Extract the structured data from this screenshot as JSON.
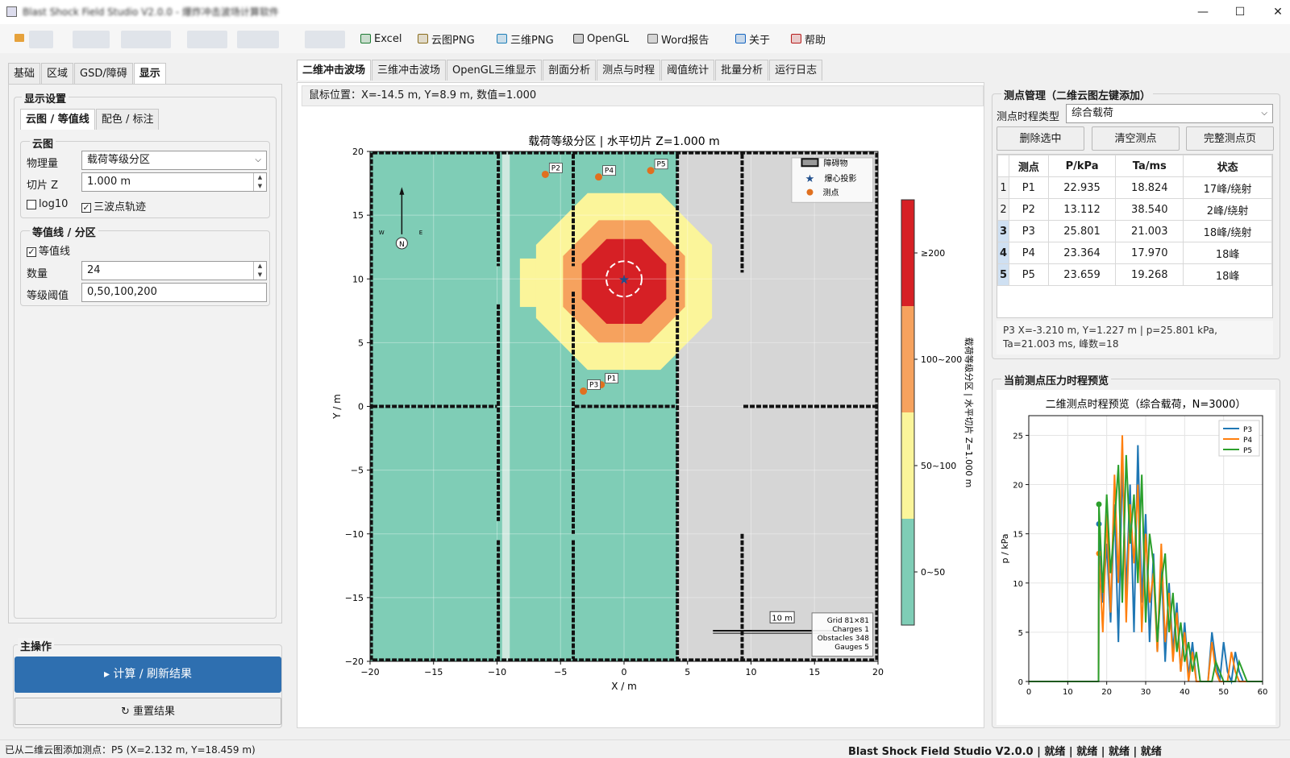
{
  "window": {
    "title": "Blast Shock Field Studio V2.0.0 - 爆炸冲击波场计算软件",
    "minimize": "—",
    "maximize": "☐",
    "close": "✕"
  },
  "toolbar": {
    "items": [
      {
        "label": "Excel",
        "icon": "excel-icon",
        "color": "#1e7b34"
      },
      {
        "label": "云图PNG",
        "icon": "image-icon",
        "color": "#8a6d1d"
      },
      {
        "label": "三维PNG",
        "icon": "globe-icon",
        "color": "#1e7fb8"
      },
      {
        "label": "OpenGL",
        "icon": "camera-icon",
        "color": "#333333"
      },
      {
        "label": "Word报告",
        "icon": "document-icon",
        "color": "#555555"
      },
      {
        "label": "关于",
        "icon": "info-icon",
        "color": "#1565c0"
      },
      {
        "label": "帮助",
        "icon": "help-icon",
        "color": "#b71c1c"
      }
    ]
  },
  "left": {
    "tabs": [
      "基础",
      "区域",
      "GSD/障碍",
      "显示"
    ],
    "active_tab": "显示",
    "display_group": "显示设置",
    "subtabs": [
      "云图 / 等值线",
      "配色 / 标注"
    ],
    "cloud_group": "云图",
    "quantity_label": "物理量",
    "quantity_value": "载荷等级分区",
    "slice_label": "切片 Z",
    "slice_value": "1.000 m",
    "log10_label": "log10",
    "log10_checked": false,
    "trace_label": "三波点轨迹",
    "trace_checked": true,
    "contour_group": "等值线 / 分区",
    "contour_label": "等值线",
    "contour_checked": true,
    "count_label": "数量",
    "count_value": "24",
    "threshold_label": "等级阈值",
    "threshold_value": "0,50,100,200",
    "main_ops": "主操作",
    "compute_button": "▸  计算 / 刷新结果",
    "reset_button": "↻  重置结果"
  },
  "center": {
    "tabs": [
      "二维冲击波场",
      "三维冲击波场",
      "OpenGL三维显示",
      "剖面分析",
      "测点与时程",
      "阈值统计",
      "批量分析",
      "运行日志"
    ],
    "active_tab": "二维冲击波场",
    "mouse_pos": "鼠标位置：X=-14.5 m, Y=8.9 m, 数值=1.000"
  },
  "chart_data": [
    {
      "type": "heatmap",
      "title": "载荷等级分区   |   水平切片 Z=1.000 m",
      "xlabel": "X / m",
      "ylabel": "Y / m",
      "xlim": [
        -20,
        20
      ],
      "ylim": [
        -20,
        20
      ],
      "xticks": [
        "−20",
        "−15",
        "−10",
        "−5",
        "0",
        "5",
        "10",
        "15",
        "20"
      ],
      "yticks": [
        "20",
        "15",
        "10",
        "5",
        "0",
        "−5",
        "−10",
        "−15",
        "−20"
      ],
      "grid": true,
      "legend": {
        "position": "top-right",
        "items": [
          "障碍物",
          "爆心投影",
          "测点"
        ]
      },
      "colorbar_label": "载荷等级分区 | 水平切片 Z=1.000 m",
      "colorbar": [
        {
          "label": "≥200",
          "color": "#d62025"
        },
        {
          "label": "100~200",
          "color": "#f6a25e"
        },
        {
          "label": "50~100",
          "color": "#fbf59a"
        },
        {
          "label": "0~50",
          "color": "#7fcdb6"
        }
      ],
      "charge": {
        "x": 0,
        "y": 10
      },
      "gauges": [
        {
          "name": "P1",
          "x": -1.8,
          "y": 1.7
        },
        {
          "name": "P2",
          "x": -6.2,
          "y": 18.2
        },
        {
          "name": "P3",
          "x": -3.2,
          "y": 1.2
        },
        {
          "name": "P4",
          "x": -2.0,
          "y": 18.0
        },
        {
          "name": "P5",
          "x": 2.1,
          "y": 18.5
        }
      ],
      "compass": [
        "N",
        "W",
        "E"
      ],
      "scalebar": "10 m",
      "info_box": [
        "Grid 81×81",
        "Charges 1",
        "Obstacles 348",
        "Gauges 5"
      ]
    },
    {
      "type": "line",
      "title": "二维测点时程预览（综合载荷，N=3000）",
      "xlabel": "",
      "ylabel": "p / kPa",
      "xlim": [
        0,
        60
      ],
      "ylim": [
        0,
        27
      ],
      "xticks": [
        "0",
        "10",
        "20",
        "30",
        "40",
        "50",
        "60"
      ],
      "yticks": [
        "25",
        "20",
        "15",
        "10",
        "5",
        "0"
      ],
      "grid": true,
      "legend": "top-right",
      "series": [
        {
          "name": "P3",
          "color": "#1f77b4",
          "x": [
            0,
            17.9,
            18,
            19,
            20,
            21,
            22,
            23,
            24,
            25,
            26,
            27,
            28,
            29,
            30,
            31,
            32,
            33,
            34,
            35,
            36,
            37,
            38,
            39,
            40,
            41,
            42,
            43,
            44,
            45,
            46,
            47,
            48,
            49,
            50,
            51,
            52,
            53,
            54,
            55,
            56,
            57,
            58,
            59,
            60
          ],
          "y": [
            0,
            0,
            16,
            8,
            14,
            6,
            18,
            4,
            22,
            9,
            20,
            5,
            24,
            8,
            17,
            4,
            13,
            3,
            12,
            2,
            10,
            3,
            8,
            1,
            6,
            0.5,
            4,
            0,
            0,
            0,
            0,
            5,
            2,
            0,
            4,
            1,
            0,
            3,
            1,
            0,
            0,
            0,
            0,
            0,
            0
          ]
        },
        {
          "name": "P4",
          "color": "#ff7f0e",
          "x": [
            0,
            17.9,
            18,
            19,
            20,
            21,
            22,
            23,
            24,
            25,
            26,
            27,
            28,
            29,
            30,
            31,
            32,
            33,
            34,
            35,
            36,
            37,
            38,
            39,
            40,
            41,
            42,
            43,
            44,
            45,
            46,
            47,
            48,
            49,
            50,
            51,
            52,
            53,
            54,
            55,
            56,
            57,
            58,
            59,
            60
          ],
          "y": [
            0,
            0,
            13,
            5,
            17,
            7,
            21,
            10,
            25,
            6,
            18,
            12,
            20,
            5,
            15,
            8,
            11,
            3,
            14,
            4,
            9,
            2,
            7,
            1,
            5,
            0,
            3,
            0,
            0,
            0,
            0,
            4,
            1,
            0,
            0,
            0,
            3,
            1,
            0,
            0,
            0,
            0,
            0,
            0,
            0
          ]
        },
        {
          "name": "P5",
          "color": "#2ca02c",
          "x": [
            0,
            17.9,
            18,
            19,
            20,
            21,
            22,
            23,
            24,
            25,
            26,
            27,
            28,
            29,
            30,
            31,
            32,
            33,
            34,
            35,
            36,
            37,
            38,
            39,
            40,
            41,
            42,
            43,
            44,
            45,
            46,
            47,
            48,
            49,
            50,
            51,
            52,
            53,
            54,
            55,
            56,
            57,
            58,
            59,
            60
          ],
          "y": [
            0,
            0,
            18,
            9,
            19,
            11,
            16,
            22,
            8,
            23,
            14,
            19,
            10,
            21,
            6,
            15,
            12,
            4,
            10,
            13,
            5,
            9,
            3,
            6,
            2,
            4,
            1,
            3,
            0,
            0,
            0,
            0,
            2,
            1,
            0,
            0,
            0,
            0,
            2,
            1,
            0,
            0,
            0,
            0,
            0
          ]
        }
      ]
    }
  ],
  "right": {
    "gauge_group": "测点管理（二维云图左键添加）",
    "type_label": "测点时程类型",
    "type_value": "综合载荷",
    "delete_button": "删除选中",
    "clear_button": "清空测点",
    "full_button": "完整测点页",
    "columns": [
      "测点",
      "P/kPa",
      "Ta/ms",
      "状态"
    ],
    "rows": [
      {
        "n": "1",
        "name": "P1",
        "p": "22.935",
        "ta": "18.824",
        "state": "17峰/绕射",
        "sel": false
      },
      {
        "n": "2",
        "name": "P2",
        "p": "13.112",
        "ta": "38.540",
        "state": "2峰/绕射",
        "sel": false
      },
      {
        "n": "3",
        "name": "P3",
        "p": "25.801",
        "ta": "21.003",
        "state": "18峰/绕射",
        "sel": true
      },
      {
        "n": "4",
        "name": "P4",
        "p": "23.364",
        "ta": "17.970",
        "state": "18峰",
        "sel": true
      },
      {
        "n": "5",
        "name": "P5",
        "p": "23.659",
        "ta": "19.268",
        "state": "18峰",
        "sel": true
      }
    ],
    "detail": "P3  X=-3.210 m, Y=1.227 m  |  p=25.801 kPa, Ta=21.003 ms, 峰数=18",
    "preview_group": "当前测点压力时程预览"
  },
  "status": {
    "left": "已从二维云图添加测点：P5 (X=2.132 m, Y=18.459 m)",
    "right": "Blast Shock Field Studio V2.0.0 | 就绪 | 就绪 | 就绪 | 就绪"
  },
  "accent": "#2e6fb0"
}
